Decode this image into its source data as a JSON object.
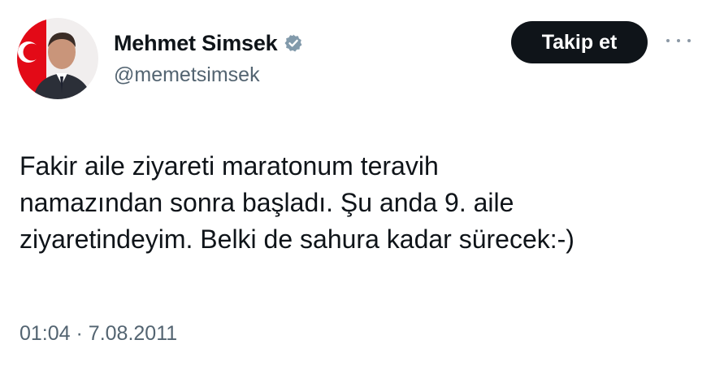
{
  "author": {
    "display_name": "Mehmet Simsek",
    "handle": "@memetsimsek",
    "verified_icon": "verified-badge-icon",
    "verified_color": "#829aab"
  },
  "actions": {
    "follow_label": "Takip et",
    "more_icon": "more-options-icon"
  },
  "tweet": {
    "text": "Fakir aile ziyareti maratonum teravih\nnamazından sonra başladı. Şu anda 9. aile\nziyaretindeyim. Belki de sahura kadar sürecek:-)",
    "time": "01:04",
    "separator": "·",
    "date": "7.08.2011"
  },
  "colors": {
    "button_bg": "#0f1419",
    "secondary_text": "#536471",
    "flag_red": "#e30a17"
  }
}
